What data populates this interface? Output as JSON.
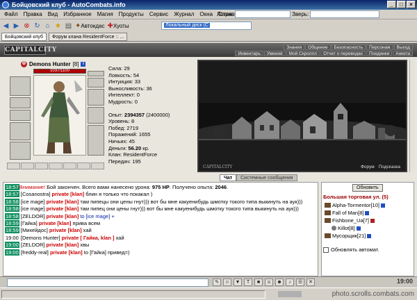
{
  "window": {
    "title": "Бойцовский клуб - AutoCombats.info"
  },
  "menu": [
    "Файл",
    "Правка",
    "Вид",
    "Избранное",
    "Магия",
    "Продукты",
    "Сервис",
    "Журнал",
    "Окна",
    "Справка"
  ],
  "menu_fields": {
    "login_label": "Логин:",
    "beast_label": "Зверь:"
  },
  "toolbar": {
    "autocast_label": "Автокдас",
    "heal_label": "Хуоты",
    "address_value": "Локальный диск (C"
  },
  "tabs": [
    "Бойцовский клуб",
    "Форум клана ResidentForce :: ..."
  ],
  "game": {
    "logo": "CAPITALCITY",
    "nav_top": [
      "Знания",
      "Общение",
      "Безопасность",
      "Персонаж",
      "Выход"
    ],
    "nav_bottom": [
      "Инвентарь",
      "Умения",
      "Мой Скроллл",
      "Отчет о переводах",
      "Поединки",
      "Анкета"
    ],
    "character": {
      "name": "Demons Hunter",
      "level": "[8]",
      "hp": "1037/1100",
      "stats": [
        "Сила: 29",
        "Ловкость: 54",
        "Интуиция: 33",
        "Выносливость: 36",
        "Интеллект: 0",
        "Мудрость: 0"
      ],
      "experience_label": "Опыт:",
      "experience_value": "2394357",
      "experience_next": "(2400000)",
      "details": [
        "Уровень: 8",
        "Побед: 2719",
        "Поражений: 1655",
        "Ничьих: 45"
      ],
      "money_label": "Деньги:",
      "money_value": "56.20",
      "money_currency": "кр.",
      "clan": "Клан: ResidentForce",
      "transfers": "Передач: 195"
    },
    "scene": {
      "label": "CAPITALCITY",
      "forum_link": "Форум",
      "hint_link": "Подсказка"
    }
  },
  "chat": {
    "tab_active": "Чат",
    "tab_system": "Системные сообщения",
    "messages": [
      {
        "time": "18:57",
        "ts_style": "green",
        "parts": [
          {
            "t": "Внимание!",
            "c": "red"
          },
          {
            "t": " Бой закончен. Всего вами нанесено урона: "
          },
          {
            "t": "975 HP",
            "c": "bold"
          },
          {
            "t": ". Получено опыта: "
          },
          {
            "t": "2046",
            "c": "bold"
          },
          {
            "t": "."
          }
        ]
      },
      {
        "time": "18:57",
        "ts_style": "green",
        "parts": [
          {
            "t": " [Cosanostra] "
          },
          {
            "t": "private [klan]",
            "c": "red-bold"
          },
          {
            "t": " блин я только что покакал )"
          }
        ]
      },
      {
        "time": "18:58",
        "ts_style": "green",
        "wrap": true,
        "parts": [
          {
            "t": " [ice mage] "
          },
          {
            "t": "private [klan]",
            "c": "red-bold"
          },
          {
            "t": " там пипецы они цены гнут))) вот бы мне какуенибудь шмотку токого типа выкинуть на аук)))"
          }
        ]
      },
      {
        "time": "18:58",
        "ts_style": "green",
        "wrap": true,
        "parts": [
          {
            "t": " [ice mage] "
          },
          {
            "t": "private [klan]",
            "c": "red-bold"
          },
          {
            "t": " там пипец они цены гнут))) вот бы мне какуенибудь шмотку токого типа выкинуть на аук)))"
          }
        ]
      },
      {
        "time": "18:58",
        "ts_style": "green",
        "parts": [
          {
            "t": " [ZELDOR] "
          },
          {
            "t": "private [klan]",
            "c": "red-bold"
          },
          {
            "t": " to [ice mage] +",
            "c": "blue"
          }
        ]
      },
      {
        "time": "18:59",
        "ts_style": "green",
        "parts": [
          {
            "t": " [Гайка] "
          },
          {
            "t": "private [klan]",
            "c": "red-bold"
          },
          {
            "t": " прива всем"
          }
        ]
      },
      {
        "time": "18:59",
        "ts_style": "green",
        "parts": [
          {
            "t": " [Михейдос] "
          },
          {
            "t": "private [klan]",
            "c": "red-bold"
          },
          {
            "t": " хай"
          }
        ]
      },
      {
        "time": "19:00",
        "ts_style": "plain",
        "parts": [
          {
            "t": " [Demons Hunter] "
          },
          {
            "t": "private [ Гайка, klan ]",
            "c": "red-bold"
          },
          {
            "t": " хай"
          }
        ]
      },
      {
        "time": "19:00",
        "ts_style": "green",
        "parts": [
          {
            "t": " [ZELDOR] "
          },
          {
            "t": "private [klan]",
            "c": "red-bold"
          },
          {
            "t": " хвы"
          }
        ]
      },
      {
        "time": "19:00",
        "ts_style": "green",
        "parts": [
          {
            "t": " [freddy-real] "
          },
          {
            "t": "private [klan]",
            "c": "red-bold"
          },
          {
            "t": " to [Гайка] привед=)"
          }
        ]
      }
    ]
  },
  "location": {
    "refresh_label": "Обновить",
    "name": "Большая торговая ул. (5)",
    "users": [
      {
        "name": "Alpha-Tormentor",
        "level": "[10]"
      },
      {
        "name": "Fall of Man",
        "level": "[8]"
      },
      {
        "name": "Fishbone_Ua",
        "level": "[7]"
      },
      {
        "name": "Killot",
        "level": "[8]"
      },
      {
        "name": "Мусорщик",
        "level": "[21]"
      }
    ],
    "auto_update_label": "Обновлять автомат."
  },
  "bottom": {
    "clock": "19:00"
  },
  "statusbar": {
    "watermark": "photo.scrolls.combats.com"
  }
}
